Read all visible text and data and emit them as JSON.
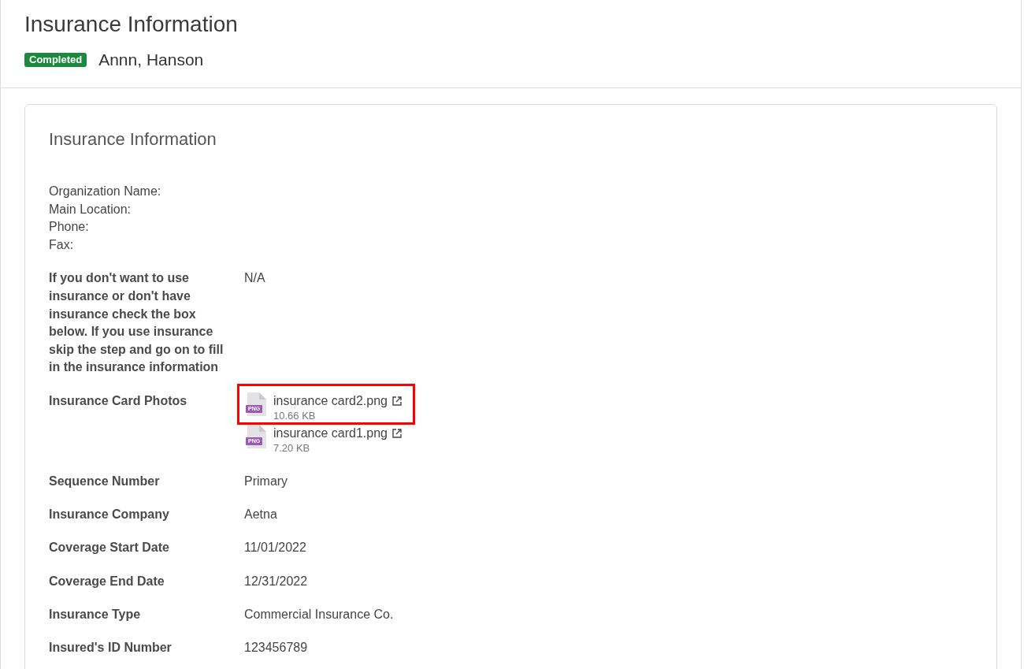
{
  "header": {
    "title": "Insurance Information",
    "status": "Completed",
    "name": "Annn, Hanson"
  },
  "card": {
    "title": "Insurance Information",
    "organization_lines": [
      "Organization Name:",
      "Main Location:",
      "Phone:",
      "Fax:"
    ],
    "fields": [
      {
        "kind": "text",
        "label": "If you don't want to use insurance or don't have insurance check the box below. If you use insurance skip the step and go on to fill in the insurance information",
        "value": "N/A"
      },
      {
        "kind": "files",
        "label": "Insurance Card Photos",
        "files": [
          {
            "name": "insurance card2.png",
            "type": "PNG",
            "size": "10.66 KB",
            "highlighted": true
          },
          {
            "name": "insurance card1.png",
            "type": "PNG",
            "size": "7.20 KB",
            "highlighted": false
          }
        ]
      },
      {
        "kind": "text",
        "label": "Sequence Number",
        "value": "Primary"
      },
      {
        "kind": "text",
        "label": "Insurance Company",
        "value": "Aetna"
      },
      {
        "kind": "text",
        "label": "Coverage Start Date",
        "value": "11/01/2022"
      },
      {
        "kind": "text",
        "label": "Coverage End Date",
        "value": "12/31/2022"
      },
      {
        "kind": "text",
        "label": "Insurance Type",
        "value": "Commercial Insurance Co."
      },
      {
        "kind": "text",
        "label": "Insured's ID Number",
        "value": "123456789"
      }
    ]
  }
}
